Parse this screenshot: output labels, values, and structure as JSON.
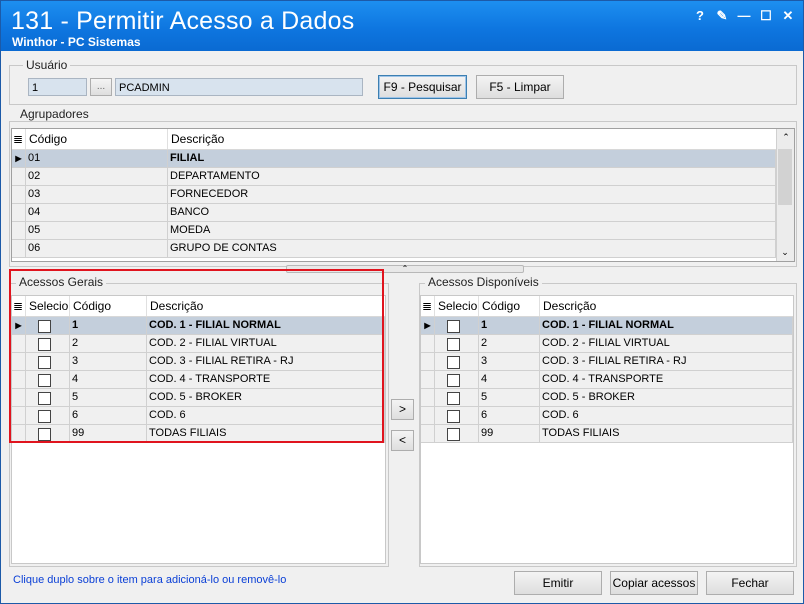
{
  "window": {
    "title": "131 - Permitir Acesso a Dados",
    "subtitle": "Winthor - PC Sistemas",
    "controls": [
      "?",
      "✎",
      "—",
      "☐",
      "✕"
    ]
  },
  "usuario": {
    "label": "Usuário",
    "code": "1",
    "lookup": "...",
    "name": "PCADMIN",
    "search_btn": "F9 - Pesquisar",
    "clear_btn": "F5 - Limpar"
  },
  "agrupadores": {
    "label": "Agrupadores",
    "headers": [
      "Código",
      "Descrição"
    ],
    "rows": [
      {
        "codigo": "01",
        "descricao": "FILIAL"
      },
      {
        "codigo": "02",
        "descricao": "DEPARTAMENTO"
      },
      {
        "codigo": "03",
        "descricao": "FORNECEDOR"
      },
      {
        "codigo": "04",
        "descricao": "BANCO"
      },
      {
        "codigo": "05",
        "descricao": "MOEDA"
      },
      {
        "codigo": "06",
        "descricao": "GRUPO DE CONTAS"
      }
    ]
  },
  "acessos_gerais": {
    "label": "Acessos Gerais",
    "headers": [
      "Selecio",
      "Código",
      "Descrição"
    ],
    "rows": [
      {
        "codigo": "1",
        "descricao": "COD. 1 - FILIAL NORMAL"
      },
      {
        "codigo": "2",
        "descricao": "COD. 2 - FILIAL VIRTUAL"
      },
      {
        "codigo": "3",
        "descricao": "COD. 3 - FILIAL RETIRA - RJ"
      },
      {
        "codigo": "4",
        "descricao": "COD. 4 - TRANSPORTE"
      },
      {
        "codigo": "5",
        "descricao": "COD. 5 - BROKER"
      },
      {
        "codigo": "6",
        "descricao": "COD. 6"
      },
      {
        "codigo": "99",
        "descricao": "TODAS FILIAIS"
      }
    ]
  },
  "acessos_disponiveis": {
    "label": "Acessos Disponíveis",
    "headers": [
      "Selecio",
      "Código",
      "Descrição"
    ],
    "rows": [
      {
        "codigo": "1",
        "descricao": "COD. 1 - FILIAL NORMAL"
      },
      {
        "codigo": "2",
        "descricao": "COD. 2 - FILIAL VIRTUAL"
      },
      {
        "codigo": "3",
        "descricao": "COD. 3 - FILIAL RETIRA - RJ"
      },
      {
        "codigo": "4",
        "descricao": "COD. 4 - TRANSPORTE"
      },
      {
        "codigo": "5",
        "descricao": "COD. 5 - BROKER"
      },
      {
        "codigo": "6",
        "descricao": "COD. 6"
      },
      {
        "codigo": "99",
        "descricao": "TODAS FILIAIS"
      }
    ]
  },
  "transfer": {
    "add": ">",
    "remove": "<"
  },
  "footer": {
    "hint": "Clique duplo sobre o item para adicioná-lo ou removê-lo",
    "emitir": "Emitir",
    "copiar": "Copiar acessos",
    "fechar": "Fechar"
  },
  "colors": {
    "titlebar": "#0e76e0",
    "selected_row": "#c4cfdc",
    "highlight_box": "#e0141e",
    "hint_text": "#0a3fd6"
  }
}
